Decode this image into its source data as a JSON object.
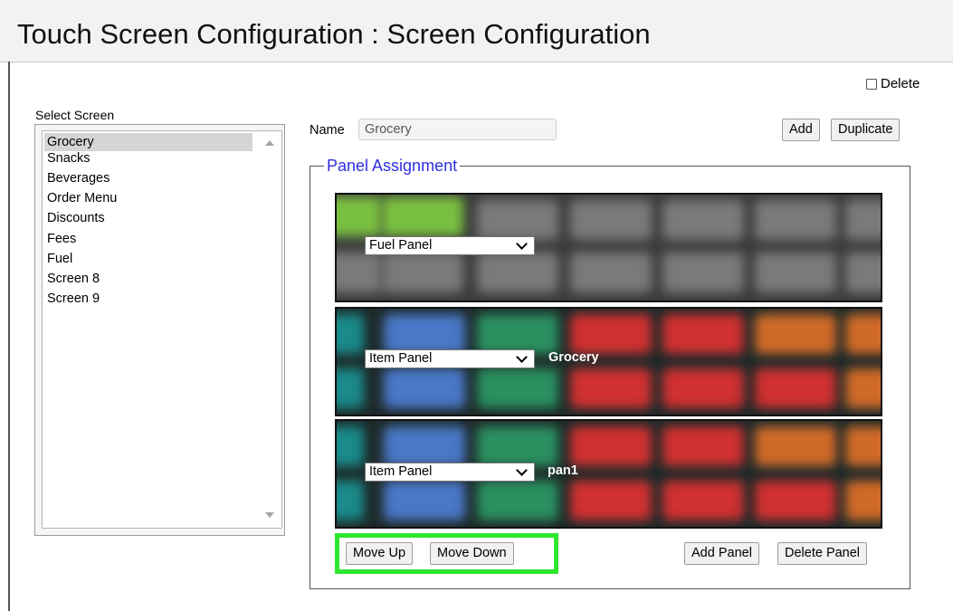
{
  "header": {
    "title": "Touch Screen Configuration : Screen Configuration"
  },
  "delete_checkbox": {
    "label": "Delete",
    "checked": false
  },
  "select_screen": {
    "label": "Select Screen",
    "selected": "Grocery",
    "items": [
      "Grocery",
      "Snacks",
      "Beverages",
      "Order Menu",
      "Discounts",
      "Fees",
      "Fuel",
      "Screen 8",
      "Screen 9"
    ]
  },
  "name_field": {
    "label": "Name",
    "value": "Grocery"
  },
  "buttons": {
    "add": "Add",
    "duplicate": "Duplicate",
    "move_up": "Move Up",
    "move_down": "Move Down",
    "add_panel": "Add Panel",
    "delete_panel": "Delete Panel"
  },
  "panel_assignment": {
    "legend": "Panel Assignment",
    "panels": [
      {
        "type": "Fuel Panel",
        "caption": ""
      },
      {
        "type": "Item Panel",
        "caption": "Grocery"
      },
      {
        "type": "Item Panel",
        "caption": "pan1"
      }
    ]
  },
  "colors": {
    "legend_text": "#2f2fe0",
    "highlight": "#2ee62e",
    "tile_teal": "#1a8a8a",
    "tile_blue": "#4a78c8",
    "tile_green": "#2a9060",
    "tile_red": "#d03030",
    "tile_orange": "#d06a28",
    "tile_gray": "#7a7a7a",
    "tile_lime": "#7ac040"
  }
}
